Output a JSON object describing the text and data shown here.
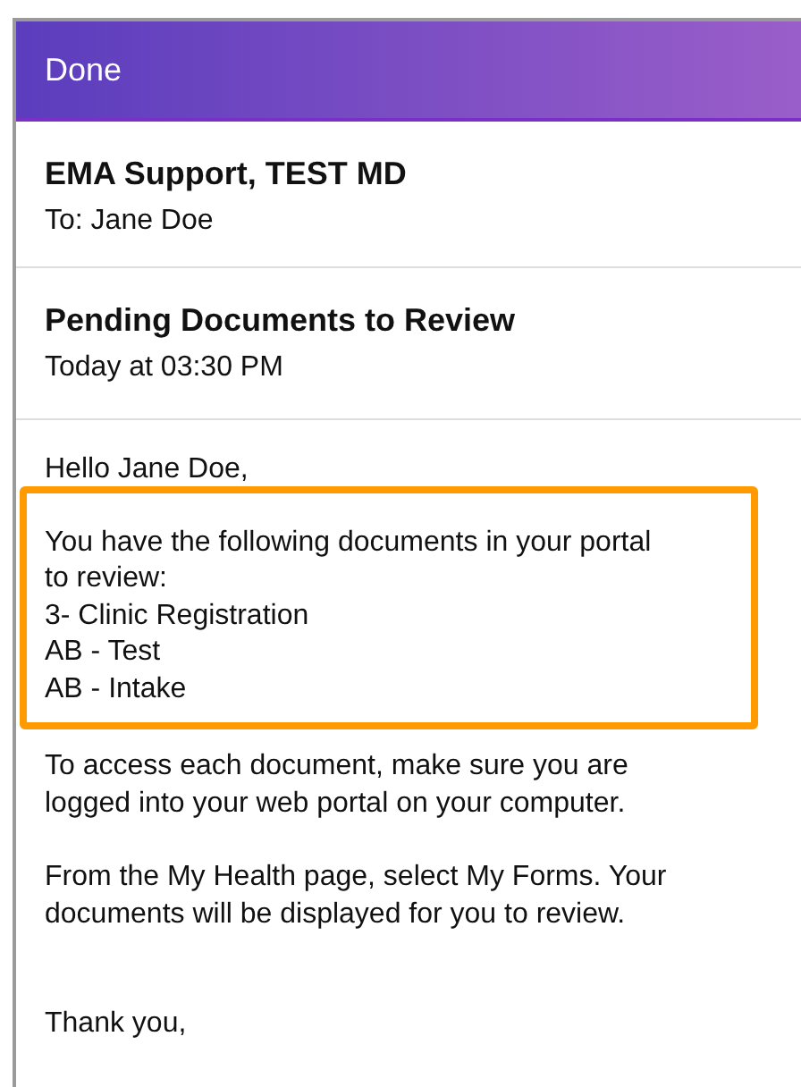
{
  "header": {
    "done_button": "Done"
  },
  "sender": {
    "name": "EMA Support, TEST MD",
    "to": "To: Jane Doe"
  },
  "subject": {
    "title": "Pending Documents to Review",
    "time": "Today at 03:30 PM"
  },
  "body": {
    "greeting": "Hello Jane Doe,",
    "highlighted": {
      "intro": [
        "You have the following documents in your portal",
        "to review:"
      ],
      "documents": [
        "3- Clinic Registration",
        "AB - Test",
        "AB - Intake"
      ]
    },
    "paragraphs": [
      [
        "To access each document, make sure you are",
        "logged into your web portal on your computer."
      ],
      [
        "From the My Health page, select My Forms.  Your",
        "documents will be displayed for you to review."
      ]
    ],
    "closing": "Thank you,"
  }
}
